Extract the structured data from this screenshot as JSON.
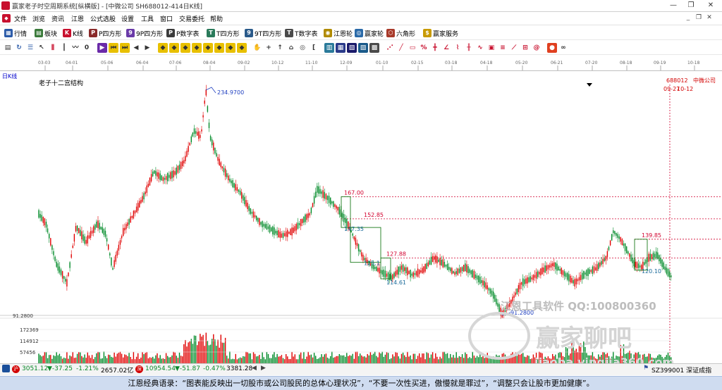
{
  "window": {
    "title": "赢家老子时空周期系统[纵横版] - [中微公司  SH688012-414日K线]",
    "min_label": "—",
    "max_label": "❐",
    "close_label": "✕"
  },
  "menu": {
    "items": [
      "文件",
      "浏览",
      "资讯",
      "江恩",
      "公式选股",
      "设置",
      "工具",
      "窗口",
      "交易委托",
      "帮助"
    ]
  },
  "toolbar1": {
    "items": [
      {
        "label": "行情",
        "icon": "grid-icon"
      },
      {
        "label": "板块",
        "icon": "blocks-icon"
      },
      {
        "label": "K线",
        "icon": "candlestick-icon"
      },
      {
        "label": "P四方形",
        "icon": "p-square-icon"
      },
      {
        "label": "9P四方形",
        "icon": "p9-square-icon"
      },
      {
        "label": "P数字表",
        "icon": "p-number-table-icon"
      },
      {
        "label": "T四方形",
        "icon": "t-square-icon"
      },
      {
        "label": "9T四方形",
        "icon": "t9-square-icon"
      },
      {
        "label": "T数字表",
        "icon": "t-number-table-icon"
      },
      {
        "label": "江恩轮",
        "icon": "gann-wheel-icon"
      },
      {
        "label": "赢家轮",
        "icon": "winner-wheel-icon"
      },
      {
        "label": "六角形",
        "icon": "hexagon-icon"
      },
      {
        "label": "赢家服务",
        "icon": "service-icon"
      }
    ]
  },
  "chart_header": {
    "period_label": "日K线",
    "indicator_name": "老子十二宫结构",
    "stock_code": "688012",
    "stock_name": "中微公司",
    "cursor_date": "09-27",
    "cursor_date2": "10-12"
  },
  "chart_data": {
    "type": "candlestick",
    "date_axis_labels": [
      "03-03",
      "04-01",
      "05-06",
      "06-04",
      "07-06",
      "08-04",
      "09-02",
      "10-12",
      "11-10",
      "12-09",
      "01-10",
      "02-15",
      "03-18",
      "04-18",
      "05-20",
      "06-21",
      "07-20",
      "08-18",
      "09-19",
      "10-18"
    ],
    "price_annotations": {
      "high_label": "234.9700",
      "low_label": "91.2800",
      "low_axis_label": "91.2800",
      "box_levels": [
        "167.00",
        "152.85",
        "147.35",
        "127.88",
        "125.1",
        "114.61",
        "139.85",
        "120.10"
      ]
    },
    "volume_axis_labels": [
      "172369",
      "114912",
      "57456"
    ],
    "price_min": 91.28,
    "price_max": 234.97,
    "candle_count": 420
  },
  "watermark": {
    "line1": "江恩工具软件  QQ:100800360",
    "line2": "赢家聊吧",
    "line3": "jiaoba.yingjia360.com"
  },
  "statusbar": {
    "sh_index": "3051.12",
    "sh_change": "▼-37.25",
    "sh_pct": "-1.21%",
    "sh_amount": "2657.02亿",
    "sz_index": "10954.54",
    "sz_change": "▼-51.87",
    "sz_pct": "-0.47%",
    "sz_amount": "3381.28",
    "right_label": "SZ399001 深证成指"
  },
  "quote": {
    "text": "江恩经典语录：“图表能反映出一切股市或公司股民的总体心理状况”，“不要一次性买进，傲慢就是罪过”，“调整只会让股市更加健康”。"
  },
  "colors": {
    "up": "#e00000",
    "down": "#008a28",
    "guide": "#d2002e",
    "box": "#1a7a1a",
    "annotation": "#2040c0"
  }
}
